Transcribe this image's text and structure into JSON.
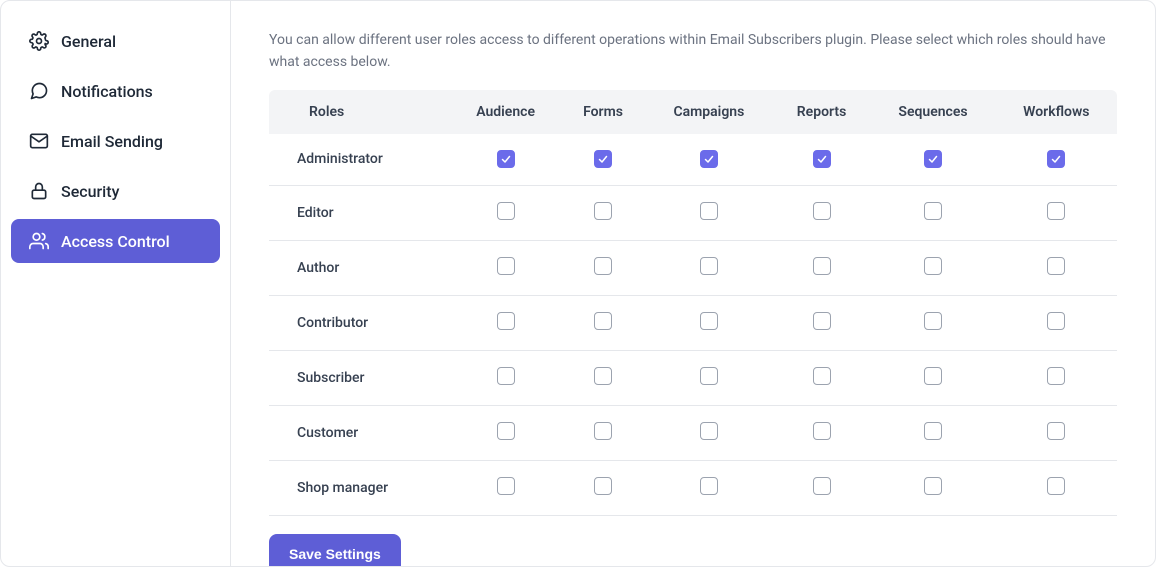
{
  "sidebar": {
    "items": [
      {
        "label": "General",
        "icon": "gear-icon",
        "active": false
      },
      {
        "label": "Notifications",
        "icon": "chat-icon",
        "active": false
      },
      {
        "label": "Email Sending",
        "icon": "mail-icon",
        "active": false
      },
      {
        "label": "Security",
        "icon": "lock-icon",
        "active": false
      },
      {
        "label": "Access Control",
        "icon": "users-icon",
        "active": true
      }
    ]
  },
  "main": {
    "description": "You can allow different user roles access to different operations within Email Subscribers plugin. Please select which roles should have what access below.",
    "columns": [
      "Roles",
      "Audience",
      "Forms",
      "Campaigns",
      "Reports",
      "Sequences",
      "Workflows"
    ],
    "rows": [
      {
        "role": "Administrator",
        "checks": [
          true,
          true,
          true,
          true,
          true,
          true
        ]
      },
      {
        "role": "Editor",
        "checks": [
          false,
          false,
          false,
          false,
          false,
          false
        ]
      },
      {
        "role": "Author",
        "checks": [
          false,
          false,
          false,
          false,
          false,
          false
        ]
      },
      {
        "role": "Contributor",
        "checks": [
          false,
          false,
          false,
          false,
          false,
          false
        ]
      },
      {
        "role": "Subscriber",
        "checks": [
          false,
          false,
          false,
          false,
          false,
          false
        ]
      },
      {
        "role": "Customer",
        "checks": [
          false,
          false,
          false,
          false,
          false,
          false
        ]
      },
      {
        "role": "Shop manager",
        "checks": [
          false,
          false,
          false,
          false,
          false,
          false
        ]
      }
    ],
    "save_label": "Save Settings"
  },
  "colors": {
    "accent": "#5e5ed6",
    "checkbox": "#6b6bea"
  }
}
